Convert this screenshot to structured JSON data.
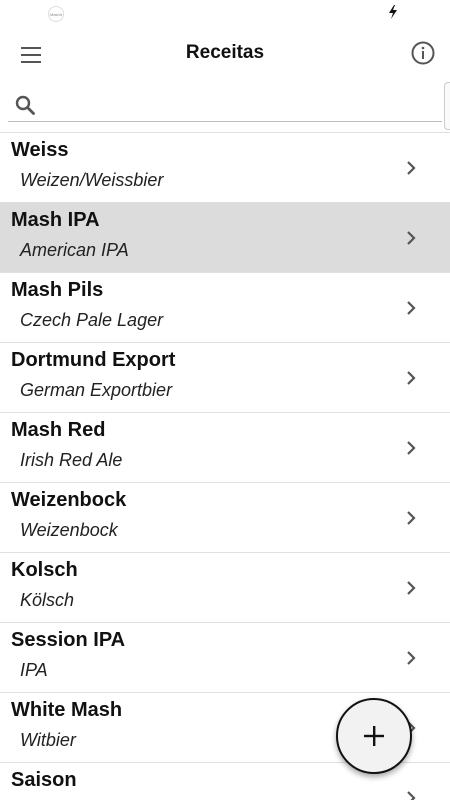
{
  "status_bar": {
    "app_icon_text": "MashIt"
  },
  "header": {
    "title": "Receitas",
    "menu_icon": "menu-icon",
    "info_icon": "info-icon"
  },
  "search": {
    "value": "",
    "placeholder": "",
    "icon": "search-icon"
  },
  "recipes": [
    {
      "name": "Weiss",
      "style": "Weizen/Weissbier",
      "selected": false
    },
    {
      "name": "Mash IPA",
      "style": "American IPA",
      "selected": true
    },
    {
      "name": "Mash Pils",
      "style": "Czech Pale Lager",
      "selected": false
    },
    {
      "name": "Dortmund Export",
      "style": "German Exportbier",
      "selected": false
    },
    {
      "name": "Mash Red",
      "style": "Irish Red Ale",
      "selected": false
    },
    {
      "name": "Weizenbock",
      "style": "Weizenbock",
      "selected": false
    },
    {
      "name": "Kolsch",
      "style": "Kölsch",
      "selected": false
    },
    {
      "name": "Session IPA",
      "style": "IPA",
      "selected": false
    },
    {
      "name": "White Mash",
      "style": "Witbier",
      "selected": false
    },
    {
      "name": "Saison",
      "style": "",
      "selected": false
    }
  ],
  "fab": {
    "icon": "plus-icon"
  },
  "colors": {
    "selected_row": "#dcdcdc",
    "divider": "#e0e0e0",
    "icon_gray": "#555555"
  }
}
